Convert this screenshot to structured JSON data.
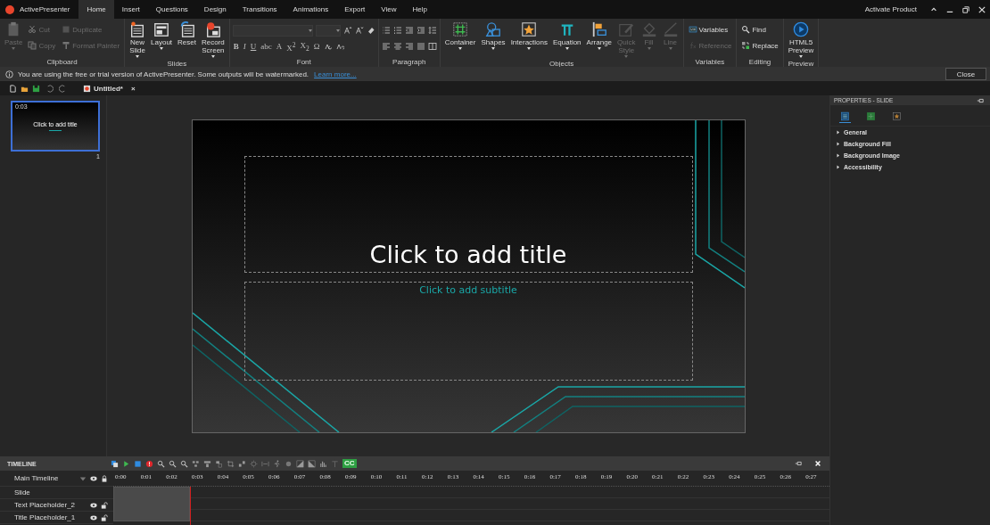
{
  "app": {
    "title": "ActivePresenter",
    "activate": "Activate Product"
  },
  "menu": [
    {
      "label": "Home",
      "selected": true
    },
    {
      "label": "Insert",
      "selected": false
    },
    {
      "label": "Questions",
      "selected": false
    },
    {
      "label": "Design",
      "selected": false
    },
    {
      "label": "Transitions",
      "selected": false
    },
    {
      "label": "Animations",
      "selected": false
    },
    {
      "label": "Export",
      "selected": false
    },
    {
      "label": "View",
      "selected": false
    },
    {
      "label": "Help",
      "selected": false
    }
  ],
  "ribbon": [
    {
      "kind": "buttons",
      "label": "Clipboard",
      "large": [
        {
          "lines": [
            "Paste"
          ],
          "disabled": true,
          "dropdown": true
        }
      ],
      "small": [
        {
          "label": "Cut",
          "disabled": true
        },
        {
          "label": "Copy",
          "disabled": true
        },
        {
          "label": "Duplicate",
          "disabled": true
        },
        {
          "label": "Format Painter",
          "disabled": true
        }
      ]
    },
    {
      "kind": "buttons",
      "label": "Slides",
      "large": [
        {
          "lines": [
            "New",
            "Slide"
          ],
          "disabled": false,
          "dropdown": true
        },
        {
          "lines": [
            "Layout"
          ],
          "disabled": false,
          "dropdown": true
        },
        {
          "lines": [
            "Reset"
          ],
          "disabled": false,
          "dropdown": false
        },
        {
          "lines": [
            "Record",
            "Screen"
          ],
          "disabled": false,
          "dropdown": true
        }
      ]
    },
    {
      "kind": "font",
      "label": "Font",
      "buttons": [
        "B",
        "I",
        "U",
        "abc",
        "A",
        "X$^{2}$",
        "X$_{2}$",
        "Ω"
      ]
    },
    {
      "kind": "paragraph",
      "label": "Paragraph"
    },
    {
      "kind": "buttons",
      "label": "Objects",
      "large": [
        {
          "lines": [
            "Container"
          ],
          "disabled": false,
          "dropdown": true
        },
        {
          "lines": [
            "Shapes"
          ],
          "disabled": false,
          "dropdown": true
        },
        {
          "lines": [
            "Interactions"
          ],
          "disabled": false,
          "dropdown": true
        },
        {
          "lines": [
            "Equation"
          ],
          "disabled": false,
          "dropdown": true
        },
        {
          "lines": [
            "Arrange"
          ],
          "disabled": false,
          "dropdown": true
        },
        {
          "lines": [
            "Quick",
            "Style"
          ],
          "disabled": true,
          "dropdown": true
        },
        {
          "lines": [
            "Fill"
          ],
          "disabled": true,
          "dropdown": true
        },
        {
          "lines": [
            "Line"
          ],
          "disabled": true,
          "dropdown": true
        }
      ]
    },
    {
      "kind": "buttons",
      "label": "Variables",
      "small": [
        {
          "label": "Variables",
          "disabled": false
        },
        {
          "label": "Reference",
          "disabled": true
        }
      ]
    },
    {
      "kind": "buttons",
      "label": "Editing",
      "small": [
        {
          "label": "Find",
          "disabled": false
        },
        {
          "label": "Replace",
          "disabled": false
        }
      ]
    },
    {
      "kind": "buttons",
      "label": "Preview",
      "large": [
        {
          "lines": [
            "HTML5",
            "Preview"
          ],
          "disabled": false,
          "dropdown": true
        }
      ]
    }
  ],
  "notice": {
    "text": "You are using the free or trial version of ActivePresenter. Some outputs will be watermarked.",
    "link": "Learn more...",
    "button": "Close"
  },
  "document_tab": {
    "label": "Untitled*",
    "close": "×"
  },
  "thumbnail": {
    "time": "0:03",
    "title": "Click to add title",
    "number": "1",
    "selected": true
  },
  "slide": {
    "title_placeholder": "Click to add title",
    "subtitle_placeholder": "Click to add subtitle"
  },
  "properties": {
    "title": "PROPERTIES - SLIDE",
    "tabs": [
      {
        "selected": true
      },
      {
        "selected": false
      },
      {
        "selected": false
      }
    ],
    "sections": [
      {
        "label": "General",
        "expanded": false
      },
      {
        "label": "Background Fill",
        "expanded": false
      },
      {
        "label": "Background Image",
        "expanded": false
      },
      {
        "label": "Accessibility",
        "expanded": false
      }
    ]
  },
  "timeline": {
    "title": "TIMELINE",
    "cc": "CC",
    "track_header": "Main Timeline",
    "ticks": [
      "0:00",
      "0:01",
      "0:02",
      "0:03",
      "0:04",
      "0:05",
      "0:06",
      "0:07",
      "0:08",
      "0:09",
      "0:10",
      "0:11",
      "0:12",
      "0:13",
      "0:14",
      "0:15",
      "0:16",
      "0:17",
      "0:18",
      "0:19",
      "0:20",
      "0:21",
      "0:22",
      "0:23",
      "0:24",
      "0:25",
      "0:26",
      "0:27"
    ],
    "playhead": {
      "level": 0.107
    },
    "rows": [
      {
        "label": "Slide",
        "controls": false
      },
      {
        "label": "Text Placeholder_2",
        "controls": true
      },
      {
        "label": "Title Placeholder_1",
        "controls": true
      }
    ]
  }
}
